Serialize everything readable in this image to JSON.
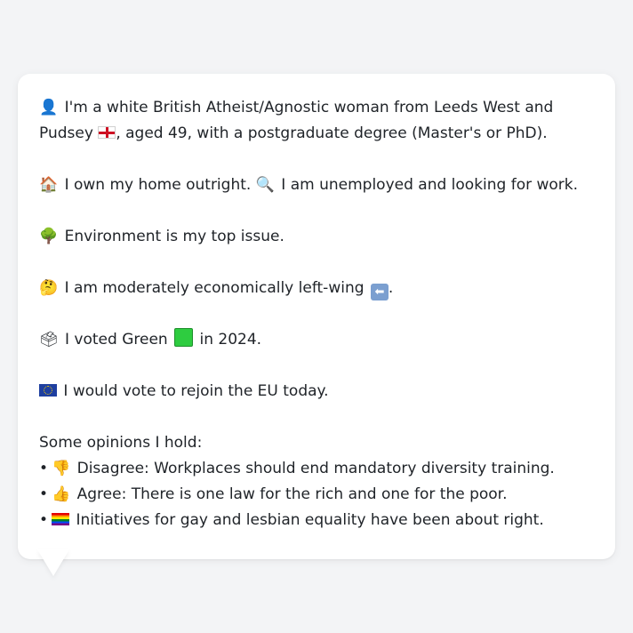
{
  "profile": {
    "intro_before": "I'm a white British Atheist/Agnostic woman from Leeds West and Pudsey",
    "intro_after": ", aged 49, with a postgraduate degree (Master's or PhD).",
    "home": "I own my home outright.",
    "work": "I am unemployed and looking for work.",
    "issue": "Environment is my top issue.",
    "economics": "I am moderately economically left-wing",
    "economics_end": ".",
    "vote_before": "I voted Green",
    "vote_after": "in 2024.",
    "eu": "I would vote to rejoin the EU today."
  },
  "opinions": {
    "heading": "Some opinions I hold:",
    "bullet": "•",
    "items": [
      {
        "icon": "thumbs-down-icon",
        "text": "Disagree: Workplaces should end mandatory diversity training."
      },
      {
        "icon": "thumbs-up-icon",
        "text": "Agree: There is one law for the rich and one for the poor."
      },
      {
        "icon": "rainbow-flag-icon",
        "text": "Initiatives for gay and lesbian equality have been about right."
      }
    ]
  },
  "icons": {
    "person": "👤",
    "house": "🏠",
    "magnifier": "🔍",
    "tree": "🌳",
    "thinking": "🤔",
    "ballot": "🗳",
    "thumbs_down": "👎",
    "thumbs_up": "👍",
    "arrow_left": "⬅"
  },
  "colors": {
    "background": "#f3f4f6",
    "bubble": "#ffffff",
    "text": "#1f2328",
    "green_square": "#2ecc40"
  }
}
